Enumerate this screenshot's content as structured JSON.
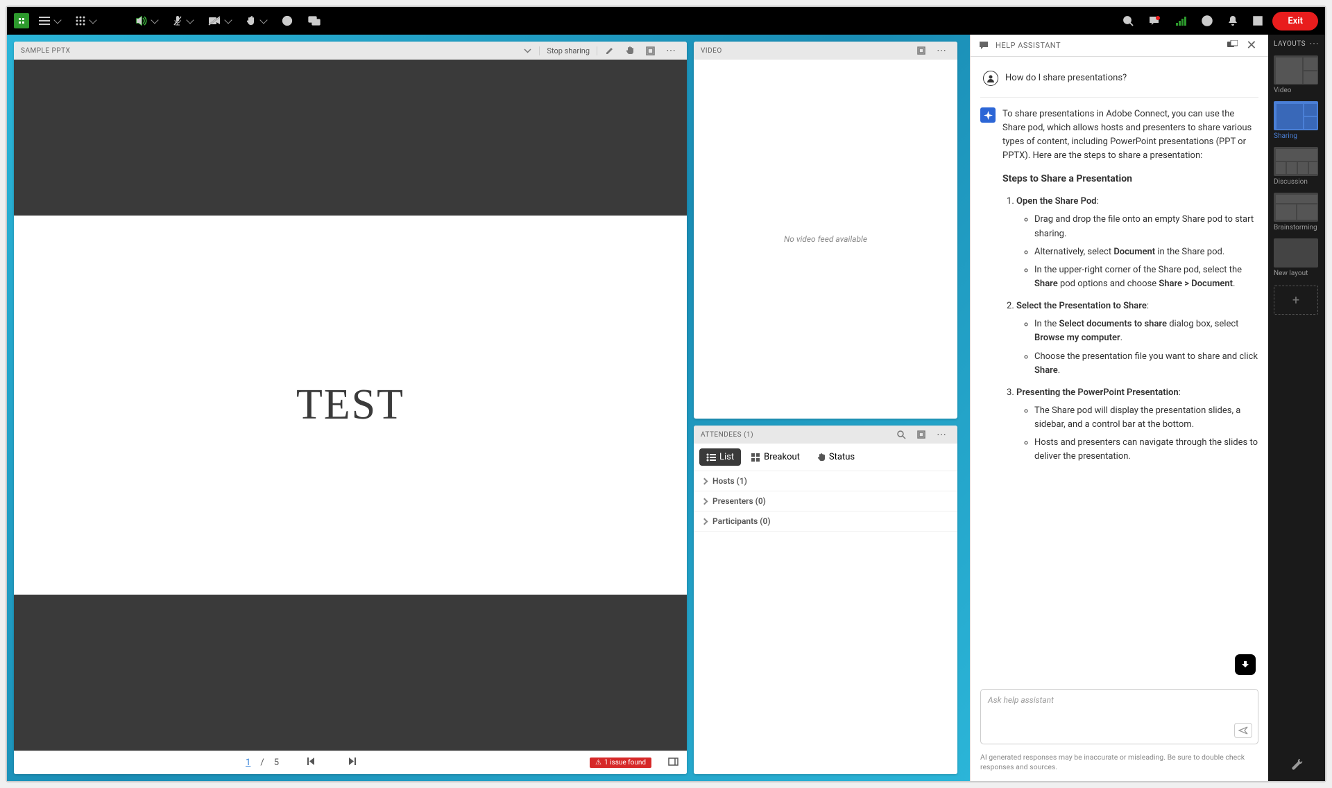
{
  "topbar": {
    "exit": "Exit"
  },
  "share": {
    "title": "SAMPLE PPTX",
    "stop": "Stop sharing",
    "slide_text": "TEST",
    "page_current": "1",
    "page_sep": "/",
    "page_total": "5",
    "issue": "1 issue found"
  },
  "video": {
    "title": "VIDEO",
    "empty": "No video feed available"
  },
  "attendees": {
    "title": "ATTENDEES  (1)",
    "tabs": {
      "list": "List",
      "breakout": "Breakout",
      "status": "Status"
    },
    "rows": {
      "hosts": "Hosts (1)",
      "presenters": "Presenters (0)",
      "participants": "Participants (0)"
    }
  },
  "help": {
    "title": "HELP ASSISTANT",
    "user_q": "How do I share presentations?",
    "intro": "To share presentations in Adobe Connect, you can use the Share pod, which allows hosts and presenters to share various types of content, including PowerPoint presentations (PPT or PPTX). Here are the steps to share a presentation:",
    "steps_heading": "Steps to Share a Presentation",
    "s1_t": "Open the Share Pod",
    "s1_a": "Drag and drop the file onto an empty Share pod to start sharing.",
    "s1_b1": "Alternatively, select ",
    "s1_b2": "Document",
    "s1_b3": " in the Share pod.",
    "s1_c1": "In the upper-right corner of the Share pod, select the ",
    "s1_c2": "Share",
    "s1_c3": " pod options and choose ",
    "s1_c4": "Share > Document",
    "s1_c5": ".",
    "s2_t": "Select the Presentation to Share",
    "s2_a1": "In the ",
    "s2_a2": "Select documents to share",
    "s2_a3": " dialog box, select ",
    "s2_a4": "Browse my computer",
    "s2_a5": ".",
    "s2_b1": "Choose the presentation file you want to share and click ",
    "s2_b2": "Share",
    "s2_b3": ".",
    "s3_t": "Presenting the PowerPoint Presentation",
    "s3_a": "The Share pod will display the presentation slides, a sidebar, and a control bar at the bottom.",
    "s3_b": "Hosts and presenters can navigate through the slides to deliver the presentation.",
    "input_placeholder": "Ask help assistant",
    "disclaimer": "AI generated responses may be inaccurate or misleading. Be sure to double check responses and sources."
  },
  "layouts": {
    "heading": "LAYOUTS",
    "video": "Video",
    "sharing": "Sharing",
    "discussion": "Discussion",
    "brainstorming": "Brainstorming",
    "new": "New layout"
  }
}
